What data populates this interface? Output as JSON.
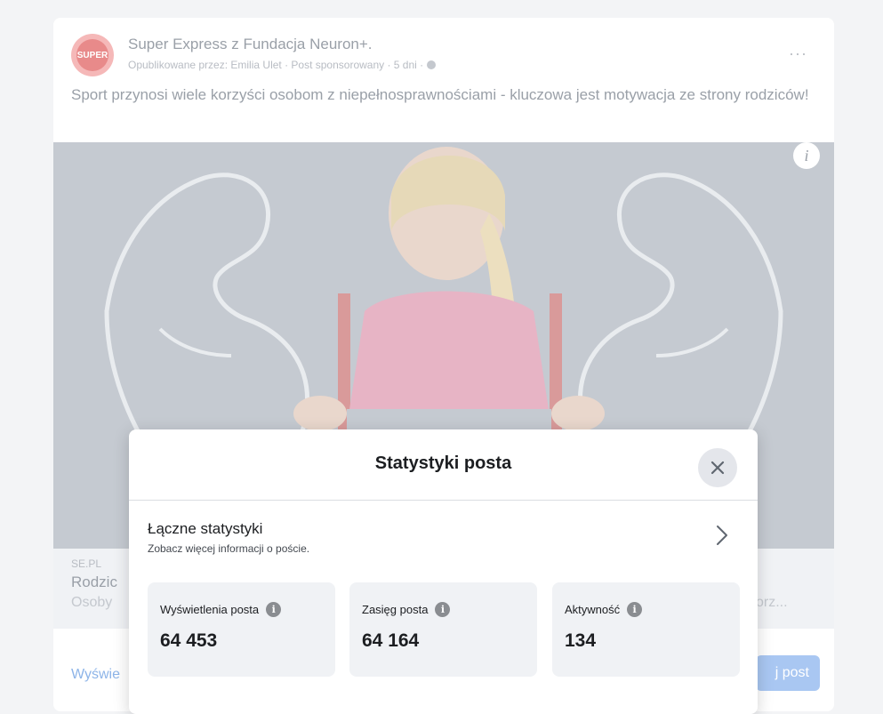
{
  "post": {
    "page_name": "Super Express z Fundacja Neuron+.",
    "meta": "Opublikowane przez: Emilia Ulet · Post sponsorowany · 5 dni ·",
    "text": "Sport przynosi wiele korzyści osobom z niepełnosprawnościami - kluczowa jest motywacja ze strony rodziców!",
    "avatar_label": "SUPER",
    "more_icon": "···",
    "image_info_icon": "i",
    "link_domain": "SE.PL",
    "link_title": "Rodzic",
    "link_desc": "Osoby",
    "link_desc_tail": "orz...",
    "see_more": "Wyświe",
    "promote_label": "j post"
  },
  "modal": {
    "title": "Statystyki posta",
    "section_title": "Łączne statystyki",
    "section_subtitle": "Zobacz więcej informacji o poście.",
    "stats": [
      {
        "label": "Wyświetlenia posta",
        "value": "64 453"
      },
      {
        "label": "Zasięg posta",
        "value": "64 164"
      },
      {
        "label": "Aktywność",
        "value": "134"
      }
    ]
  },
  "colors": {
    "accent": "#1877f2",
    "modal_bg": "#ffffff",
    "card_bg": "#f0f2f5"
  }
}
